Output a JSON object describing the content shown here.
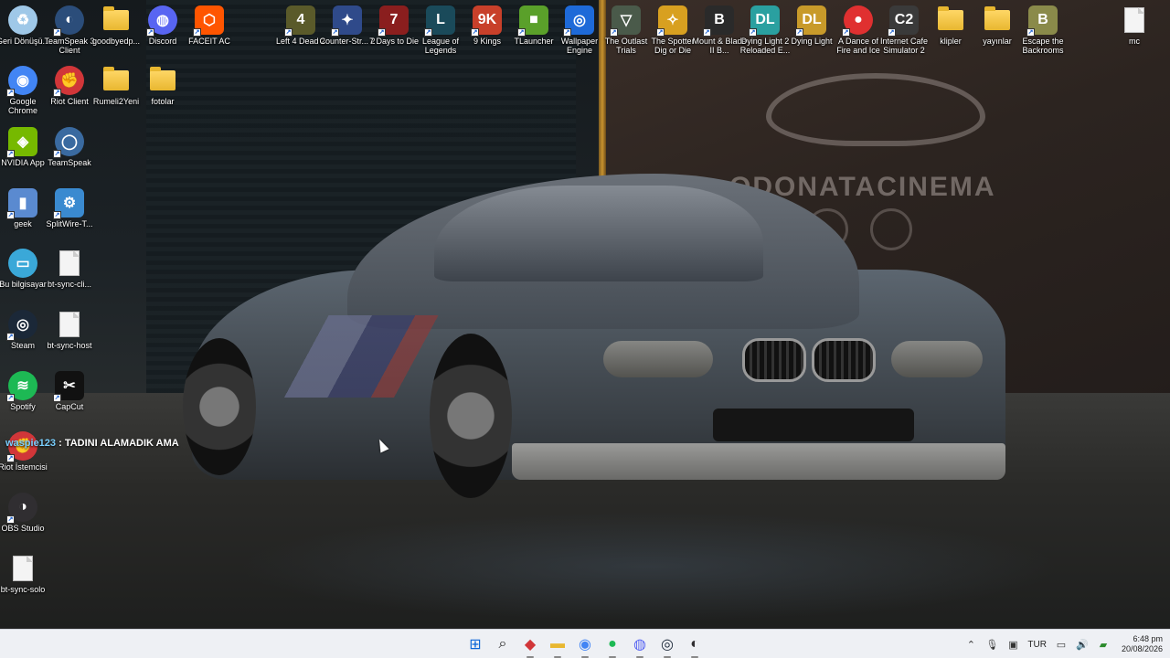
{
  "desktop": {
    "icons": [
      {
        "label": "Geri Dönüşü...",
        "icon": "recycle-bin-icon",
        "color": "#9fc8e8"
      },
      {
        "label": "TeamSpeak 3 Client",
        "icon": "teamspeak3-icon",
        "color": "#2b4d7a"
      },
      {
        "label": "goodbyedp...",
        "icon": "folder-icon",
        "color": "#ffd766"
      },
      {
        "label": "Discord",
        "icon": "discord-icon",
        "color": "#5865f2"
      },
      {
        "label": "FACEIT AC",
        "icon": "faceit-icon",
        "color": "#ff5500"
      },
      {
        "label": "Left 4 Dead 2",
        "icon": "left4dead2-icon",
        "color": "#5a5a2a"
      },
      {
        "label": "Counter-Str... 2",
        "icon": "counter-strike-icon",
        "color": "#2f4a8a"
      },
      {
        "label": "7 Days to Die",
        "icon": "7-days-to-die-icon",
        "color": "#8a1e1e"
      },
      {
        "label": "League of Legends",
        "icon": "league-of-legends-icon",
        "color": "#1a4a5a"
      },
      {
        "label": "9 Kings",
        "icon": "9-kings-icon",
        "color": "#c8402a"
      },
      {
        "label": "TLauncher",
        "icon": "tlauncher-icon",
        "color": "#5aa02a"
      },
      {
        "label": "Wallpaper Engine",
        "icon": "wallpaper-engine-icon",
        "color": "#1e6ad8"
      },
      {
        "label": "The Outlast Trials",
        "icon": "outlast-trials-icon",
        "color": "#4a5a4a"
      },
      {
        "label": "The Spotter Dig or Die",
        "icon": "spotter-dig-or-die-icon",
        "color": "#d8a020"
      },
      {
        "label": "Mount & Blade II B...",
        "icon": "mount-and-blade-icon",
        "color": "#2a2a2a"
      },
      {
        "label": "Dying Light 2 Reloaded E...",
        "icon": "dying-light-2-icon",
        "color": "#2aa0a0"
      },
      {
        "label": "Dying Light",
        "icon": "dying-light-icon",
        "color": "#c89a2a"
      },
      {
        "label": "A Dance of Fire and Ice",
        "icon": "dance-of-fire-and-ice-icon",
        "color": "#e03030"
      },
      {
        "label": "Internet Cafe Simulator 2",
        "icon": "internet-cafe-simulator-2-icon",
        "color": "#3a3a3a"
      },
      {
        "label": "klipler",
        "icon": "folder-icon",
        "color": "#ffd766"
      },
      {
        "label": "yayınlar",
        "icon": "folder-icon",
        "color": "#ffd766"
      },
      {
        "label": "Escape the Backrooms",
        "icon": "escape-the-backrooms-icon",
        "color": "#8a8a4a"
      },
      {
        "label": "mc",
        "icon": "file-icon",
        "color": "#f4f4f4"
      },
      {
        "label": "Google Chrome",
        "icon": "chrome-icon",
        "color": "#4285f4"
      },
      {
        "label": "Riot Client",
        "icon": "riot-client-icon",
        "color": "#d13639"
      },
      {
        "label": "Rumeli2Yeni",
        "icon": "folder-icon",
        "color": "#ffd766"
      },
      {
        "label": "fotolar",
        "icon": "folder-icon",
        "color": "#ffd766"
      },
      {
        "label": "NVIDIA App",
        "icon": "nvidia-icon",
        "color": "#76b900"
      },
      {
        "label": "TeamSpeak",
        "icon": "teamspeak-icon",
        "color": "#3a6aa0"
      },
      {
        "label": "geek",
        "icon": "geek-icon",
        "color": "#5a8ad0"
      },
      {
        "label": "SplitWire-T...",
        "icon": "splitwire-icon",
        "color": "#3a8ad0"
      },
      {
        "label": "Bu bilgisayar",
        "icon": "this-pc-icon",
        "color": "#3aa8d8"
      },
      {
        "label": "bt-sync-cli...",
        "icon": "file-icon",
        "color": "#f4f4f4"
      },
      {
        "label": "Steam",
        "icon": "steam-icon",
        "color": "#1b2838"
      },
      {
        "label": "bt-sync-host",
        "icon": "file-icon",
        "color": "#f4f4f4"
      },
      {
        "label": "Spotify",
        "icon": "spotify-icon",
        "color": "#1db954"
      },
      {
        "label": "CapCut",
        "icon": "capcut-icon",
        "color": "#111111"
      },
      {
        "label": "Riot İstemcisi",
        "icon": "riot-client-icon",
        "color": "#d13639"
      },
      {
        "label": "OBS Studio",
        "icon": "obs-studio-icon",
        "color": "#302e31"
      },
      {
        "label": "bt-sync-solo",
        "icon": "file-icon",
        "color": "#f4f4f4"
      }
    ]
  },
  "wallpaper": {
    "brand_text": "ODONATACINEMA"
  },
  "notification": {
    "user": "waspie123",
    "separator": " : ",
    "message": "TADINI ALAMADIK AMA"
  },
  "taskbar": {
    "apps": [
      {
        "name": "start-button",
        "glyph": "⊞",
        "color": "#0a66d8"
      },
      {
        "name": "search-icon",
        "glyph": "⌕",
        "color": "#222222"
      },
      {
        "name": "riot-client-taskbar-icon",
        "glyph": "◆",
        "color": "#d13639"
      },
      {
        "name": "file-explorer-icon",
        "glyph": "▬",
        "color": "#e8b730"
      },
      {
        "name": "chrome-taskbar-icon",
        "glyph": "◉",
        "color": "#4285f4"
      },
      {
        "name": "spotify-taskbar-icon",
        "glyph": "●",
        "color": "#1db954"
      },
      {
        "name": "discord-taskbar-icon",
        "glyph": "◍",
        "color": "#5865f2"
      },
      {
        "name": "steam-taskbar-icon",
        "glyph": "◎",
        "color": "#1b2838"
      },
      {
        "name": "obs-taskbar-icon",
        "glyph": "◐",
        "color": "#302e31"
      }
    ],
    "tray": {
      "language": "TUR",
      "time": "6:48 pm",
      "date": "20/08/2026"
    }
  }
}
